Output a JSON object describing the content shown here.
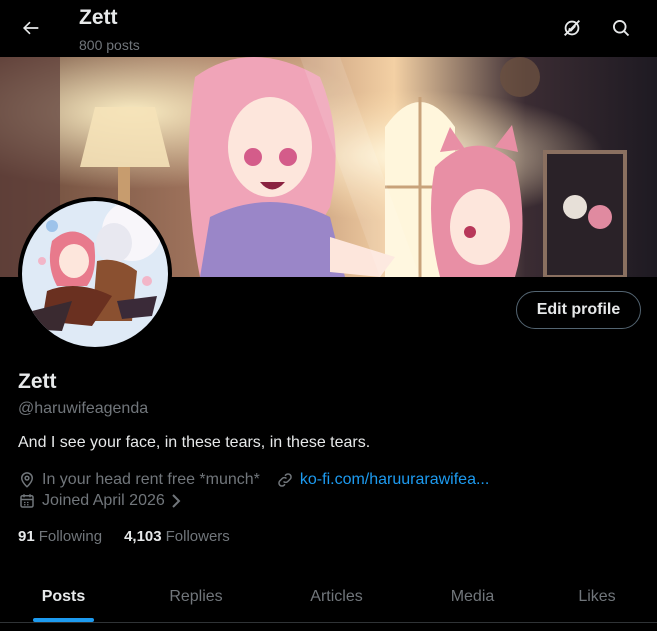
{
  "header": {
    "title": "Zett",
    "post_count": "800 posts",
    "back_icon": "arrow-left-icon",
    "premium_icon": "premium-disabled-icon",
    "search_icon": "search-icon"
  },
  "profile": {
    "display_name": "Zett",
    "handle": "@haruwifeagenda",
    "bio": "And I see your face, in these tears, in these tears.",
    "location": "In your head rent free *munch*",
    "website": "ko-fi.com/haruurarawifea...",
    "joined": "Joined April 2026",
    "edit_button": "Edit profile"
  },
  "stats": {
    "following_count": "91",
    "following_label": "Following",
    "followers_count": "4,103",
    "followers_label": "Followers"
  },
  "tabs": [
    {
      "label": "Posts",
      "active": true
    },
    {
      "label": "Replies",
      "active": false
    },
    {
      "label": "Articles",
      "active": false
    },
    {
      "label": "Media",
      "active": false
    },
    {
      "label": "Likes",
      "active": false
    }
  ],
  "colors": {
    "accent": "#1d9bf0",
    "text": "#e7e9ea",
    "muted": "#71767b",
    "background": "#000000"
  }
}
